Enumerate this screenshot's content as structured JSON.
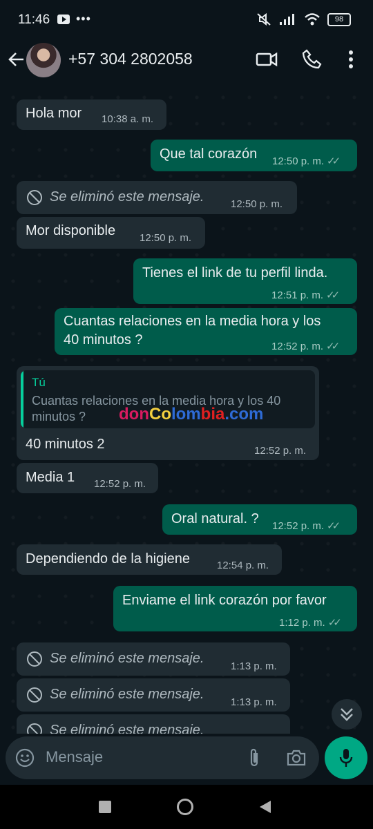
{
  "status_bar": {
    "time": "11:46",
    "battery": "98"
  },
  "header": {
    "contact": "+57 304 2802058"
  },
  "messages": [
    {
      "text": "Hola mor",
      "time": "10:38 a. m."
    },
    {
      "text": "Que tal corazón",
      "time": "12:50 p. m."
    },
    {
      "text": "Se eliminó este mensaje.",
      "time": "12:50 p. m."
    },
    {
      "text": "Mor disponible",
      "time": "12:50 p. m."
    },
    {
      "text": "Tienes el link de tu perfil linda.",
      "time": "12:51 p. m."
    },
    {
      "line1": "Cuantas relaciones en la media hora y los",
      "line2": "40 minutos ?",
      "time": "12:52 p. m."
    },
    {
      "quote_author": "Tú",
      "quote_text": "Cuantas relaciones en la media hora y los 40 minutos ?",
      "text": "40 minutos 2",
      "time": "12:52 p. m."
    },
    {
      "text": "Media 1",
      "time": "12:52 p. m."
    },
    {
      "text": "Oral natural. ?",
      "time": "12:52 p. m."
    },
    {
      "text": "Dependiendo de la higiene",
      "time": "12:54 p. m."
    },
    {
      "text": "Enviame el link corazón por favor",
      "time": "1:12 p. m."
    },
    {
      "text": "Se eliminó este mensaje.",
      "time": "1:13 p. m."
    },
    {
      "text": "Se eliminó este mensaje.",
      "time": "1:13 p. m."
    },
    {
      "text": "Se eliminó este mensaje."
    }
  ],
  "watermark": {
    "p1": "don",
    "p2": "Co",
    "p3": "lom",
    "p4": "bia",
    "p5": ".com"
  },
  "input": {
    "placeholder": "Mensaje"
  },
  "colors": {
    "incoming": "#202c33",
    "outgoing": "#005c4b",
    "accent": "#00a884",
    "background": "#0b141a"
  }
}
